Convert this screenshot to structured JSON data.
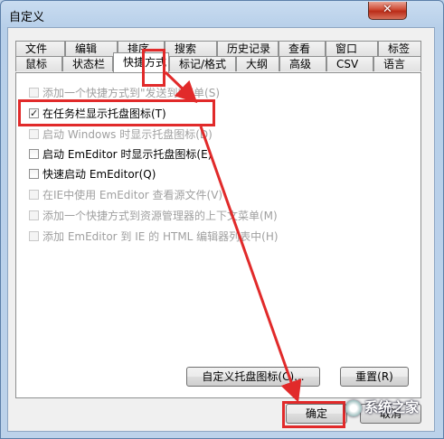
{
  "window": {
    "title": "自定义",
    "close_glyph": "✕"
  },
  "tabs_row1": [
    {
      "label": "文件"
    },
    {
      "label": "编辑"
    },
    {
      "label": "排序"
    },
    {
      "label": "搜索"
    },
    {
      "label": "历史记录"
    },
    {
      "label": "查看"
    },
    {
      "label": "窗口"
    },
    {
      "label": "标签"
    }
  ],
  "tabs_row2": [
    {
      "label": "鼠标"
    },
    {
      "label": "状态栏"
    },
    {
      "label": "快捷方式",
      "selected": true
    },
    {
      "label": "标记/格式"
    },
    {
      "label": "大纲"
    },
    {
      "label": "高级"
    },
    {
      "label": "CSV"
    },
    {
      "label": "语言"
    }
  ],
  "options": [
    {
      "label": "添加一个快捷方式到\"发送到\"菜单(S)",
      "checked": false,
      "enabled": false
    },
    {
      "label": "在任务栏显示托盘图标(T)",
      "checked": true,
      "enabled": true
    },
    {
      "label": "启动 Windows 时显示托盘图标(D)",
      "checked": false,
      "enabled": false
    },
    {
      "label": "启动 EmEditor 时显示托盘图标(E)",
      "checked": false,
      "enabled": true
    },
    {
      "label": "快速启动 EmEditor(Q)",
      "checked": false,
      "enabled": true
    },
    {
      "label": "在IE中使用 EmEditor 查看源文件(V)",
      "checked": false,
      "enabled": false
    },
    {
      "label": "添加一个快捷方式到资源管理器的上下文菜单(M)",
      "checked": false,
      "enabled": false
    },
    {
      "label": "添加 EmEditor 到 IE 的 HTML 编辑器列表中(H)",
      "checked": false,
      "enabled": false
    }
  ],
  "buttons": {
    "custom_tray": "自定义托盘图标(C)...",
    "reset": "重置(R)",
    "ok": "确定",
    "cancel": "取消"
  },
  "watermark": "系统之家",
  "colors": {
    "highlight": "#e12a2a",
    "title_gradient_top": "#c9dcf0",
    "close_red": "#c73a22"
  }
}
